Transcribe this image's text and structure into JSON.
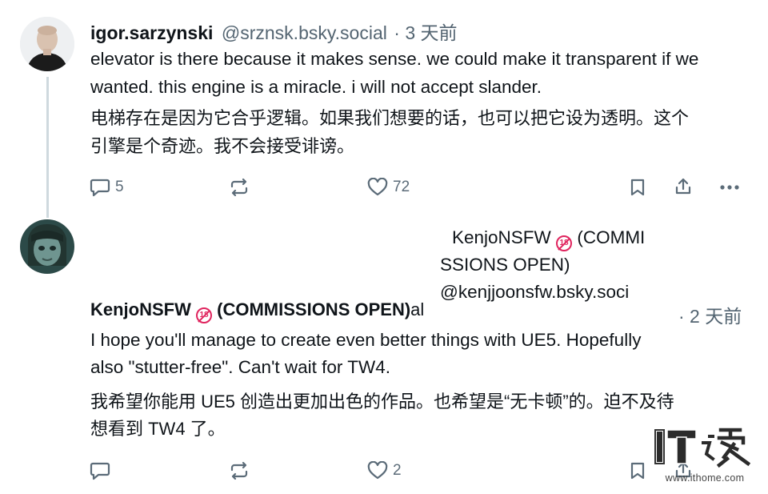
{
  "post1": {
    "author": "igor.sarzynski",
    "handle": "@srznsk.bsky.social",
    "time": "· 3 天前",
    "text_en": "elevator is there because it makes sense. we could make it transparent if we wanted. this engine is a miracle. i will not accept slander.",
    "text_cn_line1": "电梯存在是因为它合乎逻辑。如果我们想要的话，也可以把它设为透明。这个",
    "text_cn_line2": "引擎是个奇迹。我不会接受诽谤。",
    "replies": "5",
    "likes": "72"
  },
  "post2": {
    "overlay_name_line1": "KenjoNSFW",
    "overlay_name_line1b": "(COMMI",
    "overlay_name_line2": "SSIONS OPEN)",
    "overlay_handle": "@kenjjoonsfw.bsky.soci",
    "author": "KenjoNSFW",
    "author_suffix": "(COMMISSIONS OPEN)",
    "handle_tail": "al",
    "badge": "18",
    "time": "· 2 天前",
    "text_en_line1": "I hope you'll manage to create even better things with UE5. Hopefully",
    "text_en_line2": "also \"stutter-free\". Can't wait for TW4.",
    "text_cn_line1": "我希望你能用 UE5 创造出更加出色的作品。也希望是“无卡顿”的。迫不及待",
    "text_cn_line2": "想看到 TW4 了。",
    "likes": "2"
  },
  "watermark": {
    "logo": "IT之家",
    "url": "www.ithome.com"
  }
}
